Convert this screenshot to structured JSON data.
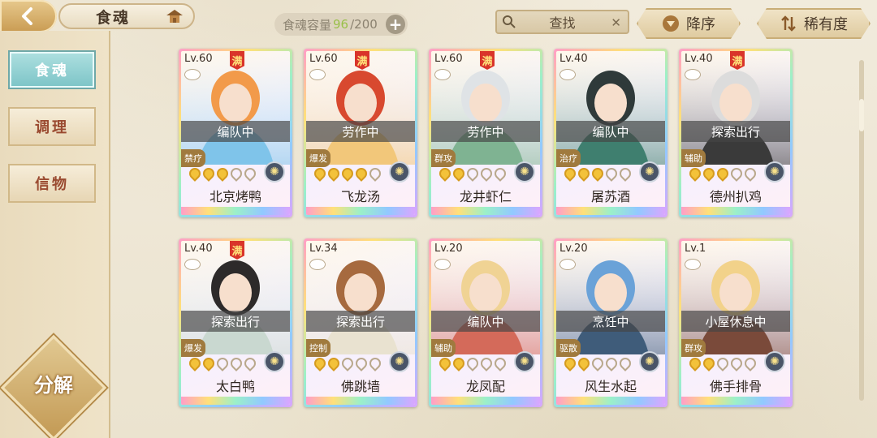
{
  "header": {
    "title": "食魂",
    "capacity_label": "食魂容量",
    "capacity_current": "96",
    "capacity_max": "/200",
    "plus": "+",
    "search_label": "查找",
    "clear": "✕",
    "sort_order_label": "降序",
    "sort_field_label": "稀有度"
  },
  "sidebar": {
    "tabs": [
      {
        "label": "食魂",
        "active": true
      },
      {
        "label": "调理",
        "active": false
      },
      {
        "label": "信物",
        "active": false
      }
    ],
    "decompose_label": "分解"
  },
  "cards": [
    {
      "level": "Lv.60",
      "max": "满",
      "status": "编队中",
      "role": "禁疗",
      "stars": 3,
      "name": "北京烤鸭",
      "palette": [
        "#f29a4a",
        "#7fc4ea"
      ]
    },
    {
      "level": "Lv.60",
      "max": "满",
      "status": "劳作中",
      "role": "爆发",
      "stars": 4,
      "name": "飞龙汤",
      "palette": [
        "#d8492f",
        "#f2c77a"
      ]
    },
    {
      "level": "Lv.60",
      "max": "满",
      "status": "劳作中",
      "role": "群攻",
      "stars": 2,
      "name": "龙井虾仁",
      "palette": [
        "#dfe3e6",
        "#7fb392"
      ]
    },
    {
      "level": "Lv.40",
      "max": "",
      "status": "编队中",
      "role": "治疗",
      "stars": 3,
      "name": "屠苏酒",
      "palette": [
        "#2f3a3a",
        "#3f7f6f"
      ]
    },
    {
      "level": "Lv.40",
      "max": "满",
      "status": "探索出行",
      "role": "辅助",
      "stars": 3,
      "name": "德州扒鸡",
      "palette": [
        "#dcdcdc",
        "#3a3a3a"
      ]
    },
    {
      "level": "Lv.40",
      "max": "满",
      "status": "探索出行",
      "role": "爆发",
      "stars": 2,
      "name": "太白鸭",
      "palette": [
        "#2d2a2a",
        "#c9d8d0"
      ]
    },
    {
      "level": "Lv.34",
      "max": "",
      "status": "探索出行",
      "role": "控制",
      "stars": 2,
      "name": "佛跳墙",
      "palette": [
        "#a66a3f",
        "#e9e2d0"
      ]
    },
    {
      "level": "Lv.20",
      "max": "",
      "status": "编队中",
      "role": "辅助",
      "stars": 2,
      "name": "龙凤配",
      "palette": [
        "#f0d394",
        "#d46a5a"
      ]
    },
    {
      "level": "Lv.20",
      "max": "",
      "status": "烹饪中",
      "role": "驱散",
      "stars": 2,
      "name": "风生水起",
      "palette": [
        "#6aa2d8",
        "#3f5c7a"
      ]
    },
    {
      "level": "Lv.1",
      "max": "",
      "status": "小屋休息中",
      "role": "群攻",
      "stars": 2,
      "name": "佛手排骨",
      "palette": [
        "#f2d28a",
        "#7a4a3a"
      ]
    }
  ]
}
